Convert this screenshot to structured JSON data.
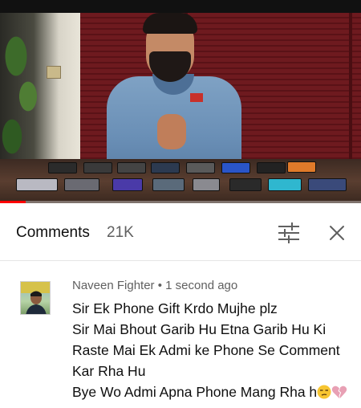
{
  "video": {
    "progress_fraction": 0.07,
    "progress_color": "#ff0000"
  },
  "comments_header": {
    "title": "Comments",
    "count": "21K",
    "sort_icon": "sort-sliders-icon",
    "close_icon": "close-icon"
  },
  "comment": {
    "author": "Naveen Fighter",
    "separator": "•",
    "time": "1 second ago",
    "lines": [
      "Sir Ek Phone Gift Krdo Mujhe plz",
      "Sir Mai Bhout Garib Hu Etna Garib Hu Ki",
      "Raste Mai Ek Admi ke Phone Se  Comment",
      "Kar Rha Hu",
      "Bye Wo Admi Apna Phone Mang Rha h"
    ],
    "emojis": [
      "unamused-face-emoji",
      "broken-heart-emoji"
    ]
  },
  "colors": {
    "text_primary": "#0f0f0f",
    "text_secondary": "#606060",
    "divider": "#e5e5e5",
    "accent_red": "#ff0000"
  }
}
